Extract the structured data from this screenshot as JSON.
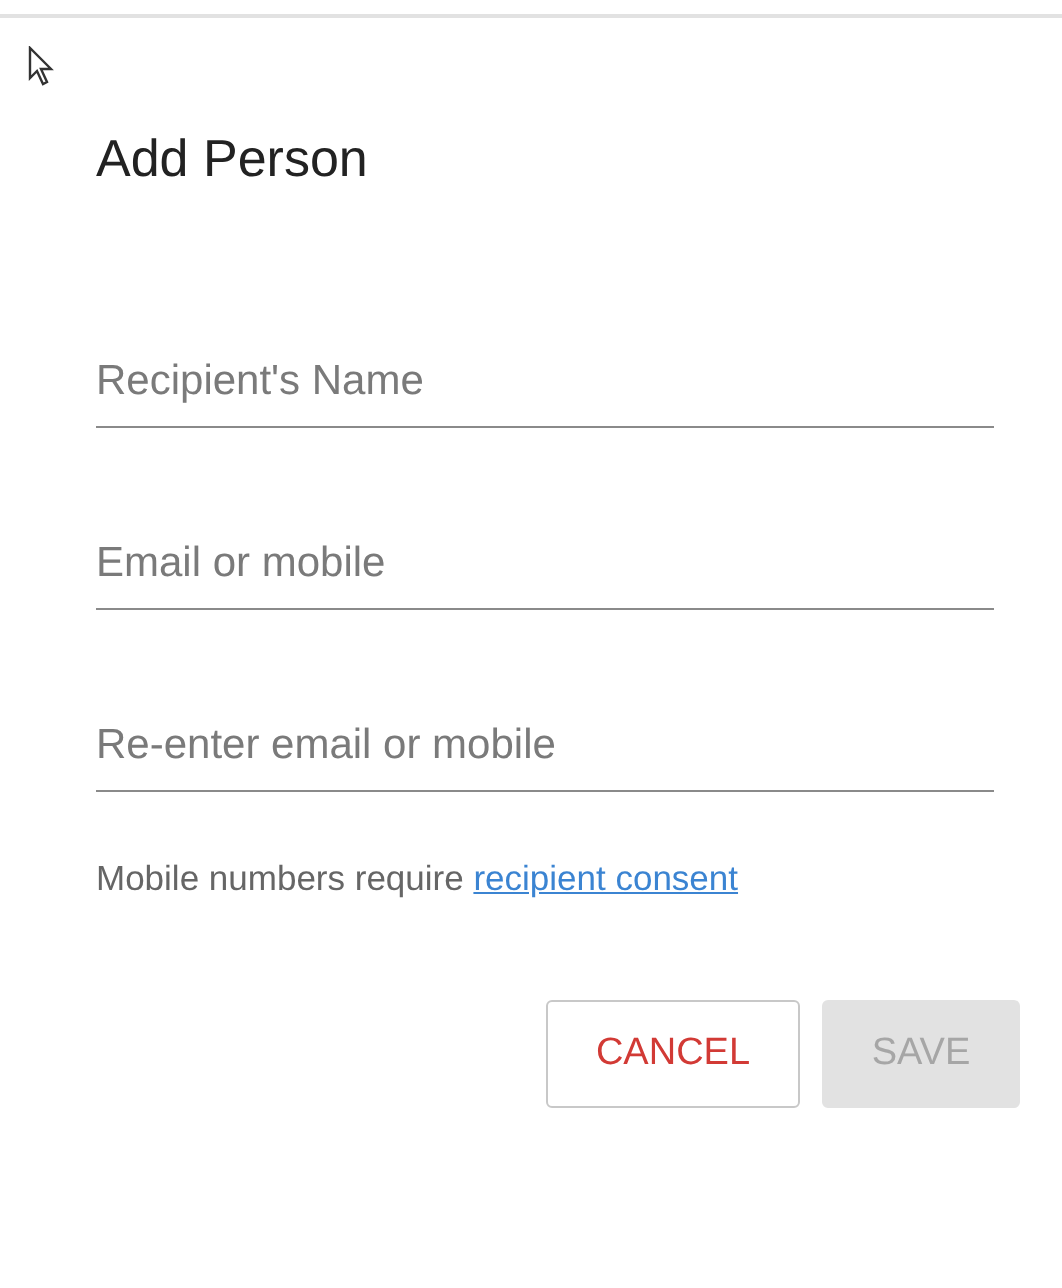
{
  "dialog": {
    "title": "Add Person",
    "fields": [
      {
        "placeholder": "Recipient's Name"
      },
      {
        "placeholder": "Email or mobile"
      },
      {
        "placeholder": "Re-enter email or mobile"
      }
    ],
    "note": {
      "text": "Mobile numbers require",
      "link": "recipient consent"
    },
    "buttons": [
      {
        "label": "CANCEL",
        "kind": "cancel",
        "disabled": false
      },
      {
        "label": "SAVE",
        "kind": "save",
        "disabled": true
      }
    ]
  }
}
